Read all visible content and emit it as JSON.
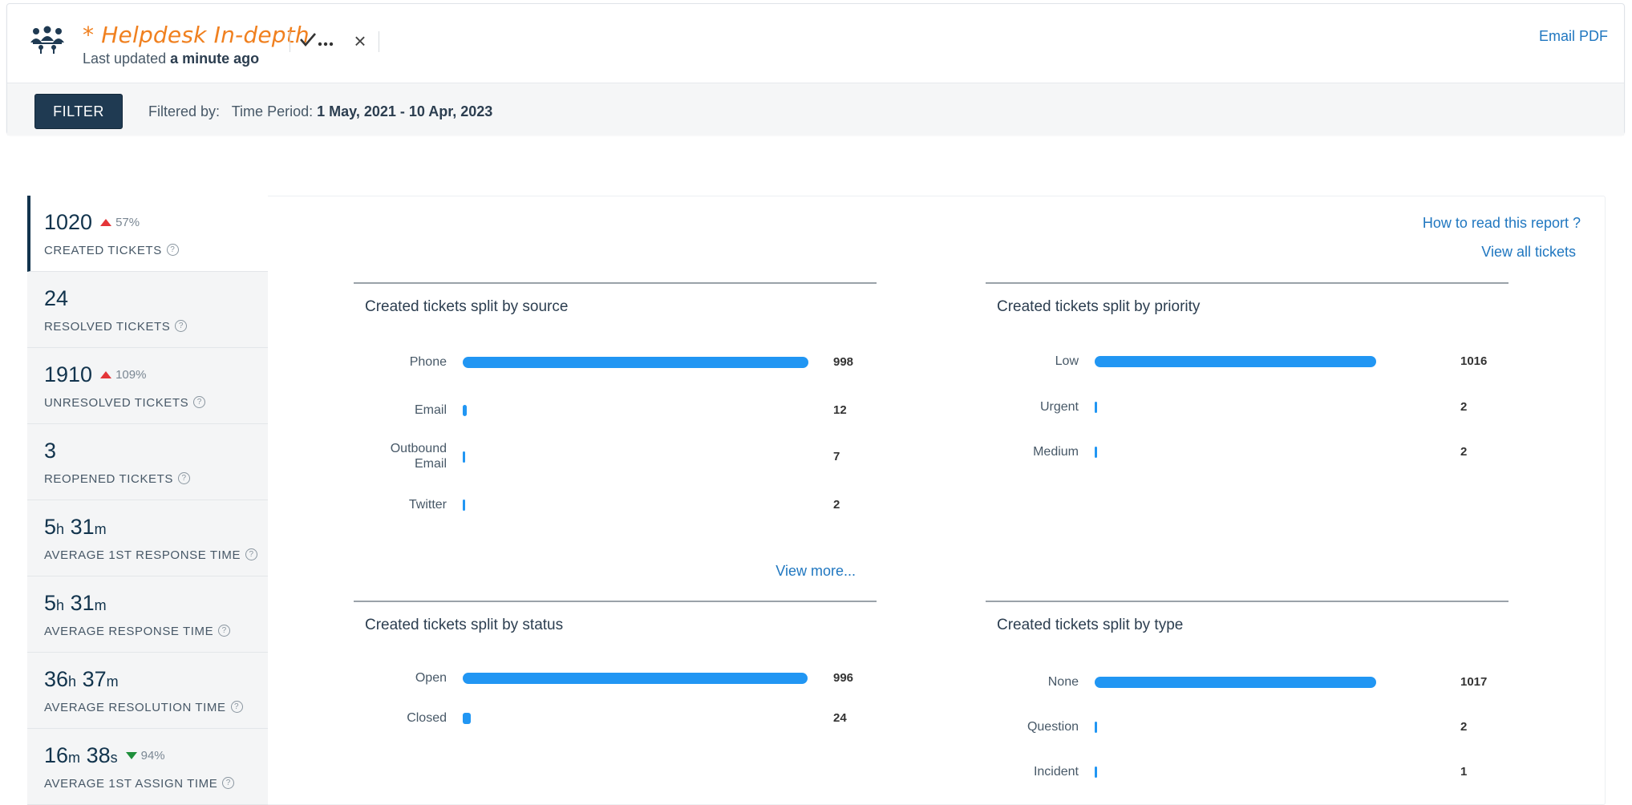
{
  "header": {
    "title": "* Helpdesk In-depth",
    "last_updated_prefix": "Last updated",
    "last_updated_value": "a minute ago",
    "email_pdf": "Email PDF",
    "close_symbol": "×",
    "filter_button": "FILTER",
    "filtered_by": "Filtered by:",
    "time_period_label": "Time Period:",
    "time_period_value": "1 May, 2021 - 10 Apr, 2023",
    "icons": [
      "people-group-icon",
      "save-check-icon",
      "close-icon"
    ]
  },
  "links": {
    "how_to_read": "How to read this report ?",
    "view_all": "View all tickets"
  },
  "metrics": [
    {
      "value": "1020",
      "delta": "57%",
      "trend": "up",
      "label": "CREATED TICKETS",
      "active": true
    },
    {
      "value": "24",
      "label": "RESOLVED TICKETS"
    },
    {
      "value": "1910",
      "delta": "109%",
      "trend": "up",
      "label": "UNRESOLVED TICKETS"
    },
    {
      "value": "3",
      "label": "REOPENED TICKETS"
    },
    {
      "h": "5",
      "m": "31",
      "label": "AVERAGE 1ST RESPONSE TIME"
    },
    {
      "h": "5",
      "m": "31",
      "label": "AVERAGE RESPONSE TIME"
    },
    {
      "h": "36",
      "m": "37",
      "label": "AVERAGE RESOLUTION TIME"
    },
    {
      "m": "16",
      "s": "38",
      "delta": "94%",
      "trend": "down",
      "label": "AVERAGE 1ST ASSIGN TIME"
    }
  ],
  "units": {
    "h": "h",
    "m": "m",
    "s": "s"
  },
  "colors": {
    "bar": "#2196f3",
    "accent_orange": "#f0801f",
    "link": "#2077c0",
    "up": "#e43538",
    "down": "#1e8f3b"
  },
  "chart_data": [
    {
      "type": "bar",
      "title": "Created tickets split by source",
      "categories": [
        "Phone",
        "Email",
        "Outbound Email",
        "Twitter"
      ],
      "values": [
        998,
        12,
        7,
        2
      ],
      "view_more": "View more..."
    },
    {
      "type": "bar",
      "title": "Created tickets split by priority",
      "categories": [
        "Low",
        "Urgent",
        "Medium"
      ],
      "values": [
        1016,
        2,
        2
      ]
    },
    {
      "type": "bar",
      "title": "Created tickets split by status",
      "categories": [
        "Open",
        "Closed"
      ],
      "values": [
        996,
        24
      ]
    },
    {
      "type": "bar",
      "title": "Created tickets split by type",
      "categories": [
        "None",
        "Question",
        "Incident"
      ],
      "values": [
        1017,
        2,
        1
      ]
    }
  ]
}
